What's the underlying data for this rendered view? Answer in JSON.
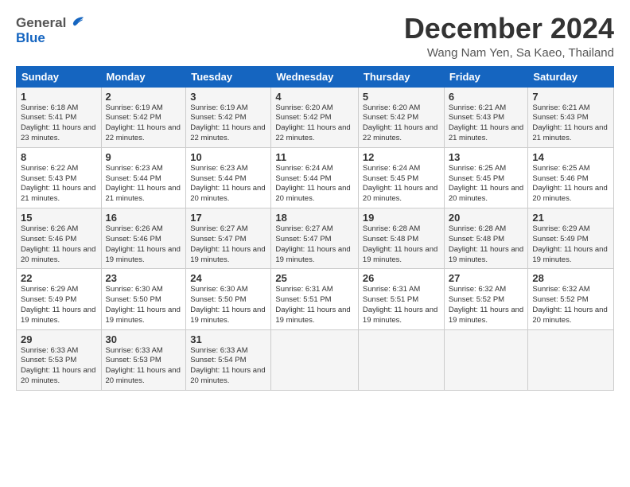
{
  "header": {
    "logo_general": "General",
    "logo_blue": "Blue",
    "month_title": "December 2024",
    "location": "Wang Nam Yen, Sa Kaeo, Thailand"
  },
  "calendar": {
    "days_of_week": [
      "Sunday",
      "Monday",
      "Tuesday",
      "Wednesday",
      "Thursday",
      "Friday",
      "Saturday"
    ],
    "weeks": [
      [
        {
          "day": "1",
          "sunrise": "Sunrise: 6:18 AM",
          "sunset": "Sunset: 5:41 PM",
          "daylight": "Daylight: 11 hours and 23 minutes."
        },
        {
          "day": "2",
          "sunrise": "Sunrise: 6:19 AM",
          "sunset": "Sunset: 5:42 PM",
          "daylight": "Daylight: 11 hours and 22 minutes."
        },
        {
          "day": "3",
          "sunrise": "Sunrise: 6:19 AM",
          "sunset": "Sunset: 5:42 PM",
          "daylight": "Daylight: 11 hours and 22 minutes."
        },
        {
          "day": "4",
          "sunrise": "Sunrise: 6:20 AM",
          "sunset": "Sunset: 5:42 PM",
          "daylight": "Daylight: 11 hours and 22 minutes."
        },
        {
          "day": "5",
          "sunrise": "Sunrise: 6:20 AM",
          "sunset": "Sunset: 5:42 PM",
          "daylight": "Daylight: 11 hours and 22 minutes."
        },
        {
          "day": "6",
          "sunrise": "Sunrise: 6:21 AM",
          "sunset": "Sunset: 5:43 PM",
          "daylight": "Daylight: 11 hours and 21 minutes."
        },
        {
          "day": "7",
          "sunrise": "Sunrise: 6:21 AM",
          "sunset": "Sunset: 5:43 PM",
          "daylight": "Daylight: 11 hours and 21 minutes."
        }
      ],
      [
        {
          "day": "8",
          "sunrise": "Sunrise: 6:22 AM",
          "sunset": "Sunset: 5:43 PM",
          "daylight": "Daylight: 11 hours and 21 minutes."
        },
        {
          "day": "9",
          "sunrise": "Sunrise: 6:23 AM",
          "sunset": "Sunset: 5:44 PM",
          "daylight": "Daylight: 11 hours and 21 minutes."
        },
        {
          "day": "10",
          "sunrise": "Sunrise: 6:23 AM",
          "sunset": "Sunset: 5:44 PM",
          "daylight": "Daylight: 11 hours and 20 minutes."
        },
        {
          "day": "11",
          "sunrise": "Sunrise: 6:24 AM",
          "sunset": "Sunset: 5:44 PM",
          "daylight": "Daylight: 11 hours and 20 minutes."
        },
        {
          "day": "12",
          "sunrise": "Sunrise: 6:24 AM",
          "sunset": "Sunset: 5:45 PM",
          "daylight": "Daylight: 11 hours and 20 minutes."
        },
        {
          "day": "13",
          "sunrise": "Sunrise: 6:25 AM",
          "sunset": "Sunset: 5:45 PM",
          "daylight": "Daylight: 11 hours and 20 minutes."
        },
        {
          "day": "14",
          "sunrise": "Sunrise: 6:25 AM",
          "sunset": "Sunset: 5:46 PM",
          "daylight": "Daylight: 11 hours and 20 minutes."
        }
      ],
      [
        {
          "day": "15",
          "sunrise": "Sunrise: 6:26 AM",
          "sunset": "Sunset: 5:46 PM",
          "daylight": "Daylight: 11 hours and 20 minutes."
        },
        {
          "day": "16",
          "sunrise": "Sunrise: 6:26 AM",
          "sunset": "Sunset: 5:46 PM",
          "daylight": "Daylight: 11 hours and 19 minutes."
        },
        {
          "day": "17",
          "sunrise": "Sunrise: 6:27 AM",
          "sunset": "Sunset: 5:47 PM",
          "daylight": "Daylight: 11 hours and 19 minutes."
        },
        {
          "day": "18",
          "sunrise": "Sunrise: 6:27 AM",
          "sunset": "Sunset: 5:47 PM",
          "daylight": "Daylight: 11 hours and 19 minutes."
        },
        {
          "day": "19",
          "sunrise": "Sunrise: 6:28 AM",
          "sunset": "Sunset: 5:48 PM",
          "daylight": "Daylight: 11 hours and 19 minutes."
        },
        {
          "day": "20",
          "sunrise": "Sunrise: 6:28 AM",
          "sunset": "Sunset: 5:48 PM",
          "daylight": "Daylight: 11 hours and 19 minutes."
        },
        {
          "day": "21",
          "sunrise": "Sunrise: 6:29 AM",
          "sunset": "Sunset: 5:49 PM",
          "daylight": "Daylight: 11 hours and 19 minutes."
        }
      ],
      [
        {
          "day": "22",
          "sunrise": "Sunrise: 6:29 AM",
          "sunset": "Sunset: 5:49 PM",
          "daylight": "Daylight: 11 hours and 19 minutes."
        },
        {
          "day": "23",
          "sunrise": "Sunrise: 6:30 AM",
          "sunset": "Sunset: 5:50 PM",
          "daylight": "Daylight: 11 hours and 19 minutes."
        },
        {
          "day": "24",
          "sunrise": "Sunrise: 6:30 AM",
          "sunset": "Sunset: 5:50 PM",
          "daylight": "Daylight: 11 hours and 19 minutes."
        },
        {
          "day": "25",
          "sunrise": "Sunrise: 6:31 AM",
          "sunset": "Sunset: 5:51 PM",
          "daylight": "Daylight: 11 hours and 19 minutes."
        },
        {
          "day": "26",
          "sunrise": "Sunrise: 6:31 AM",
          "sunset": "Sunset: 5:51 PM",
          "daylight": "Daylight: 11 hours and 19 minutes."
        },
        {
          "day": "27",
          "sunrise": "Sunrise: 6:32 AM",
          "sunset": "Sunset: 5:52 PM",
          "daylight": "Daylight: 11 hours and 19 minutes."
        },
        {
          "day": "28",
          "sunrise": "Sunrise: 6:32 AM",
          "sunset": "Sunset: 5:52 PM",
          "daylight": "Daylight: 11 hours and 20 minutes."
        }
      ],
      [
        {
          "day": "29",
          "sunrise": "Sunrise: 6:33 AM",
          "sunset": "Sunset: 5:53 PM",
          "daylight": "Daylight: 11 hours and 20 minutes."
        },
        {
          "day": "30",
          "sunrise": "Sunrise: 6:33 AM",
          "sunset": "Sunset: 5:53 PM",
          "daylight": "Daylight: 11 hours and 20 minutes."
        },
        {
          "day": "31",
          "sunrise": "Sunrise: 6:33 AM",
          "sunset": "Sunset: 5:54 PM",
          "daylight": "Daylight: 11 hours and 20 minutes."
        },
        null,
        null,
        null,
        null
      ]
    ]
  }
}
